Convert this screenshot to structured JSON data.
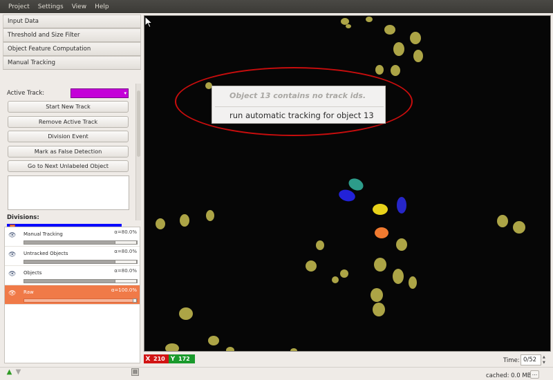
{
  "menubar": {
    "items": [
      "Project",
      "Settings",
      "View",
      "Help"
    ]
  },
  "sidebar": {
    "sections": [
      "Input Data",
      "Threshold and Size Filter",
      "Object Feature Computation",
      "Manual Tracking"
    ],
    "active_track_label": "Active Track:",
    "active_track_value": "",
    "active_track_color": "#c400d8",
    "buttons": [
      "Start New Track",
      "Remove Active Track",
      "Division Event",
      "Mark as False Detection",
      "Go to Next Unlabeled Object"
    ],
    "divisions_label": "Divisions:"
  },
  "layers": [
    {
      "name": "Manual Tracking",
      "alpha": "α=80.0%",
      "visible": true,
      "active": false,
      "opacity": 0.8
    },
    {
      "name": "Untracked Objects",
      "alpha": "α=80.0%",
      "visible": true,
      "active": false,
      "opacity": 0.8
    },
    {
      "name": "Objects",
      "alpha": "α=80.0%",
      "visible": true,
      "active": false,
      "opacity": 0.8
    },
    {
      "name": "Raw",
      "alpha": "α=100.0%",
      "visible": true,
      "active": true,
      "opacity": 1.0
    }
  ],
  "viewer": {
    "context_menu": {
      "disabled_item": "Object 13 contains no track ids.",
      "item": "run automatic tracking for object 13"
    }
  },
  "status": {
    "x_axis": "X",
    "x_value": "210",
    "y_axis": "Y",
    "y_value": "172",
    "time_label": "Time:",
    "time_value": "0/52",
    "cached": "cached: 0.0 MB",
    "more": "..."
  },
  "colors": {
    "accent": "#f07a48",
    "annotation": "#c90d0d",
    "x_axis": "#d11414",
    "y_axis": "#1a9a2c"
  }
}
